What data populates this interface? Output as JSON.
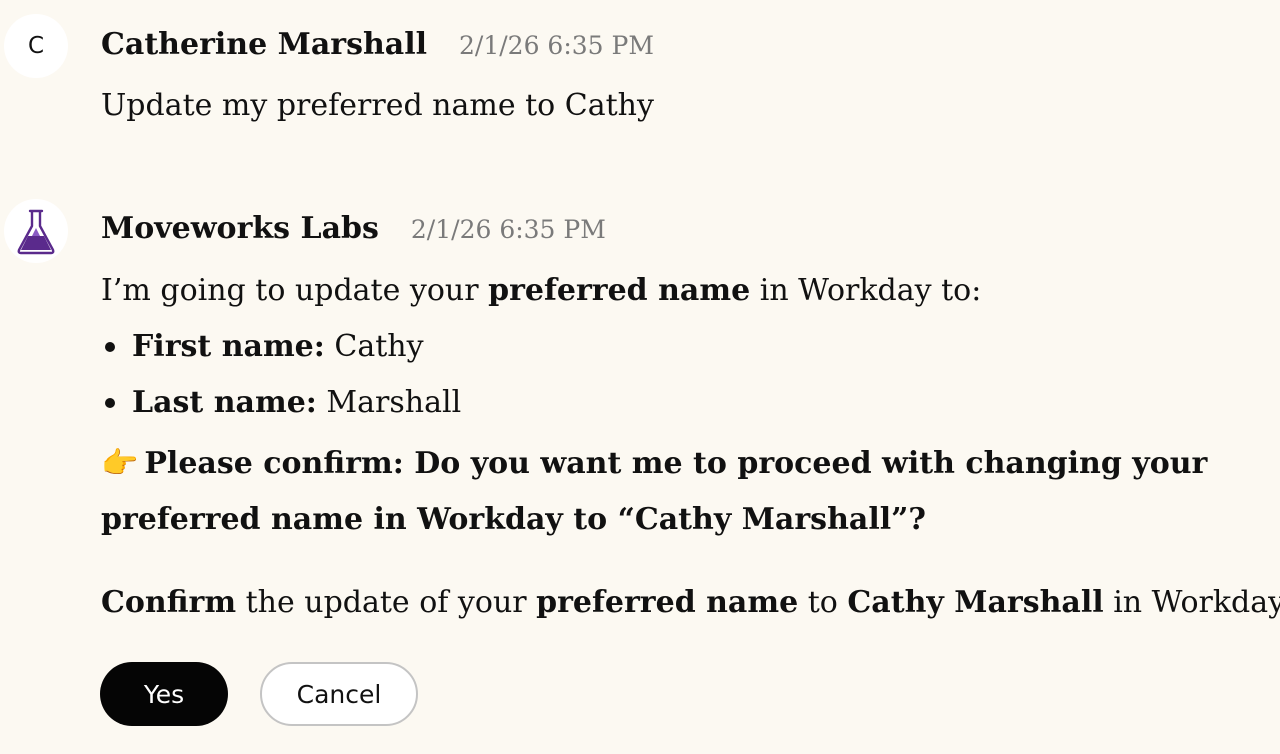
{
  "user_message": {
    "avatar_letter": "C",
    "sender": "Catherine Marshall",
    "timestamp": "2/1/26 6:35 PM",
    "text": "Update my preferred name to Cathy"
  },
  "bot_message": {
    "avatar_icon": "flask-icon",
    "sender": "Moveworks Labs",
    "timestamp": "2/1/26 6:35 PM",
    "intro": {
      "prefix": "I’m going to update your ",
      "bold": "preferred name",
      "suffix": " in Workday to:"
    },
    "bullets": [
      {
        "label": "First name:",
        "value": " Cathy"
      },
      {
        "label": "Last name:",
        "value": " Marshall"
      }
    ],
    "confirm_emoji": "👉",
    "confirm_text": "Please confirm: Do you want me to proceed with changing your preferred name in Workday to “Cathy Marshall”?",
    "summary": {
      "part1": "Confirm",
      "part2": " the update of your ",
      "part3": "preferred name",
      "part4": " to ",
      "part5": "Cathy Marshall",
      "part6": " in Workday."
    },
    "buttons": {
      "yes_label": "Yes",
      "cancel_label": "Cancel"
    }
  },
  "colors": {
    "background": "#fcf9f2",
    "flask_purple": "#5a2a8c",
    "timestamp_gray": "#7a7a7a",
    "yes_button": "#050505"
  }
}
